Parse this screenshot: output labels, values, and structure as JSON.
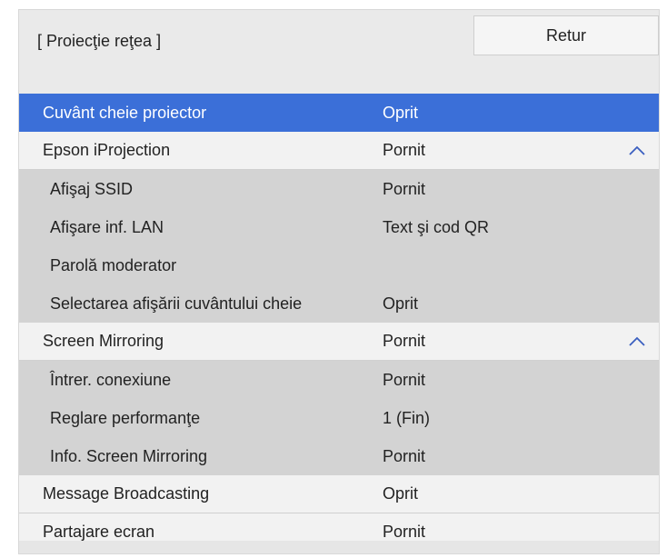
{
  "header": {
    "title": "[ Proiecţie reţea ]",
    "back_label": "Retur"
  },
  "menu": {
    "items": [
      {
        "label": "Cuvânt cheie proiector",
        "value": "Oprit",
        "selected": true
      },
      {
        "label": "Epson iProjection",
        "value": "Pornit",
        "expanded": true,
        "icon": "chevron-up-icon"
      },
      {
        "label": "Afişaj SSID",
        "value": "Pornit",
        "sub": true
      },
      {
        "label": "Afişare inf. LAN",
        "value": "Text şi cod QR",
        "sub": true
      },
      {
        "label": "Parolă moderator",
        "value": "",
        "sub": true
      },
      {
        "label": "Selectarea afişării cuvântului cheie",
        "value": "Oprit",
        "sub": true
      },
      {
        "label": "Screen Mirroring",
        "value": "Pornit",
        "expanded": true,
        "icon": "chevron-up-icon"
      },
      {
        "label": "Întrer. conexiune",
        "value": "Pornit",
        "sub": true
      },
      {
        "label": "Reglare performanţe",
        "value": "1 (Fin)",
        "sub": true
      },
      {
        "label": "Info. Screen Mirroring",
        "value": "Pornit",
        "sub": true
      },
      {
        "label": "Message Broadcasting",
        "value": "Oprit"
      },
      {
        "label": "Partajare ecran",
        "value": "Pornit"
      }
    ]
  },
  "colors": {
    "selected": "#3b6fd8",
    "sub_row": "#d3d3d3",
    "row": "#f2f2f2"
  }
}
